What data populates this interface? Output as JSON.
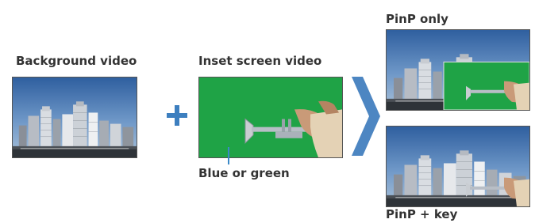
{
  "labels": {
    "background_video": "Background video",
    "inset_screen_video": "Inset screen video",
    "blue_or_green": "Blue or green",
    "pinp_only": "PinP only",
    "pinp_key": "PinP + key"
  },
  "colors": {
    "green_screen": "#1fa346",
    "plus_sign": "#3d7fbf",
    "arrow": "#4d86c2",
    "pointer": "#3a8ac8",
    "label_text": "#333333"
  },
  "icons": {
    "plus": "plus-icon",
    "arrow": "right-chevron-arrow-icon"
  }
}
